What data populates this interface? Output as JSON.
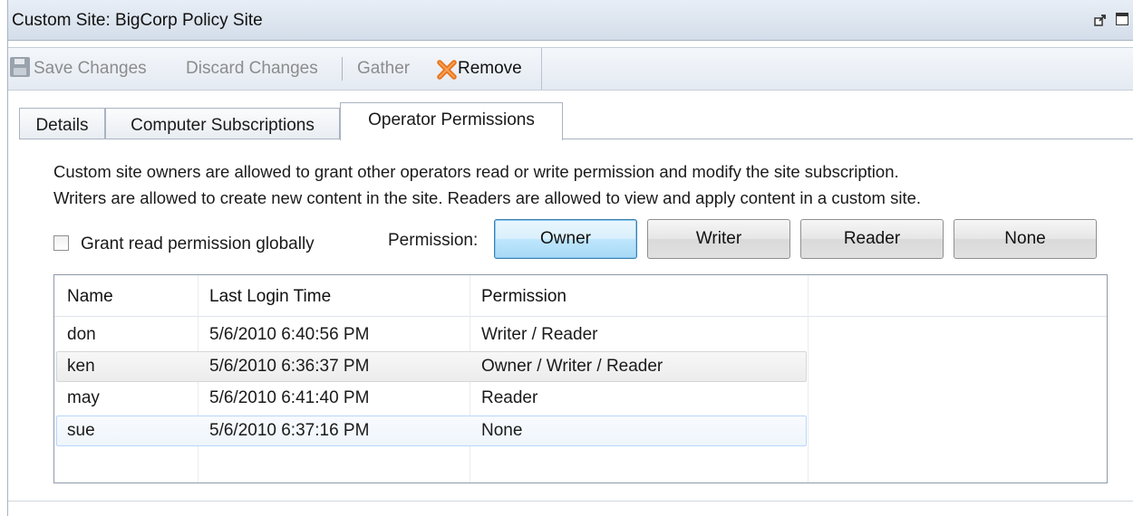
{
  "window": {
    "title": "Custom Site: BigCorp Policy Site",
    "icons": [
      "popout-icon",
      "maximize-icon"
    ]
  },
  "toolbar": {
    "save_label": "Save Changes",
    "discard_label": "Discard Changes",
    "gather_label": "Gather",
    "remove_label": "Remove",
    "save_icon": "floppy-disk-icon",
    "remove_icon": "orange-x-icon"
  },
  "tabs": [
    {
      "label": "Details",
      "active": false
    },
    {
      "label": "Computer Subscriptions",
      "active": false
    },
    {
      "label": "Operator Permissions",
      "active": true
    }
  ],
  "description": {
    "line1": "Custom site owners are allowed to grant other operators read or write permission and modify the site subscription.",
    "line2": "Writers are allowed to create new content in the site. Readers are allowed to view and apply content in a custom site."
  },
  "grant_global": {
    "label": "Grant read permission globally",
    "checked": false
  },
  "permission": {
    "label": "Permission:",
    "buttons": [
      "Owner",
      "Writer",
      "Reader",
      "None"
    ],
    "focused": "Owner"
  },
  "operators": {
    "columns": [
      "Name",
      "Last Login Time",
      "Permission"
    ],
    "rows": [
      {
        "name": "don",
        "last_login": "5/6/2010 6:40:56 PM",
        "permission": "Writer / Reader"
      },
      {
        "name": "ken",
        "last_login": "5/6/2010 6:36:37 PM",
        "permission": "Owner / Writer / Reader"
      },
      {
        "name": "may",
        "last_login": "5/6/2010 6:41:40 PM",
        "permission": "Reader"
      },
      {
        "name": "sue",
        "last_login": "5/6/2010 6:37:16 PM",
        "permission": "None"
      }
    ],
    "hovered_row": "ken",
    "selected_row": "sue"
  },
  "colors": {
    "titlebar": "#d3dde9",
    "focus_button": "#bee6fd",
    "selection_border": "#b8d6fb",
    "remove_icon": "#e8731a"
  }
}
